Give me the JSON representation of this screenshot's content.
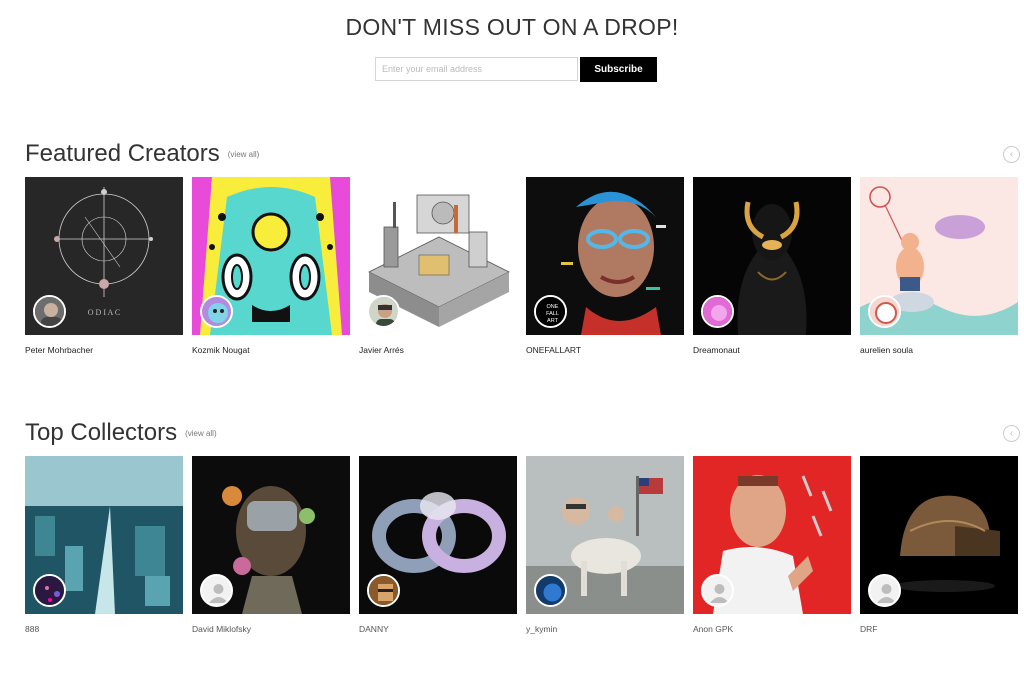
{
  "newsletter": {
    "heading": "DON'T MISS OUT ON A DROP!",
    "email_placeholder": "Enter your email address",
    "subscribe_label": "Subscribe"
  },
  "featured": {
    "title": "Featured Creators",
    "view_all": "(view all)",
    "creators": [
      {
        "name": "Peter Mohrbacher",
        "art": "zodiac",
        "art_text": "O D I A C"
      },
      {
        "name": "Kozmik Nougat",
        "art": "psychedelic"
      },
      {
        "name": "Javier Arrés",
        "art": "isometric-city"
      },
      {
        "name": "ONEFALLART",
        "art": "glitch-portrait",
        "badge_text": [
          "ONE",
          "FALL",
          "ART"
        ]
      },
      {
        "name": "Dreamonaut",
        "art": "golden-bust"
      },
      {
        "name": "aurelien soula",
        "art": "pastel-illustration"
      }
    ]
  },
  "collectors": {
    "title": "Top Collectors",
    "view_all": "(view all)",
    "items": [
      {
        "name": "888",
        "art": "teal-city"
      },
      {
        "name": "David Miklofsky",
        "art": "robot-flowers"
      },
      {
        "name": "DANNY",
        "art": "chrome-infinity"
      },
      {
        "name": "y_kymin",
        "art": "horse-rider"
      },
      {
        "name": "Anon GPK",
        "art": "red-knives-portrait"
      },
      {
        "name": "DRF",
        "art": "bronze-helmet"
      }
    ]
  },
  "icons": {
    "carousel_prev": "chevron-left-icon",
    "default_avatar": "user-icon"
  }
}
